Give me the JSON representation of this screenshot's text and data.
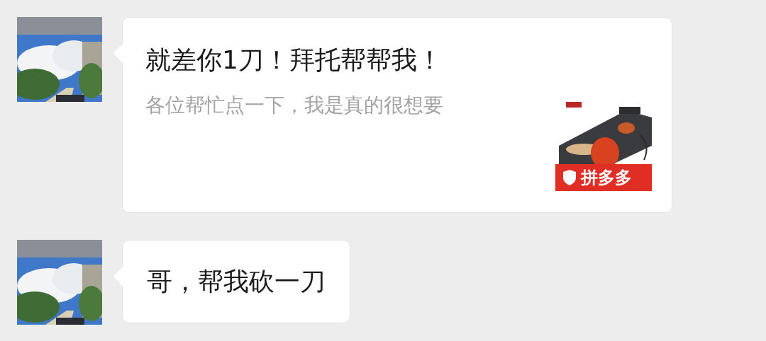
{
  "messages": [
    {
      "kind": "card",
      "title": "就差你1刀！拜托帮帮我！",
      "description": "各位帮忙点一下，我是真的很想要",
      "thumbnail": {
        "kind": "picture",
        "badge": "拼多多"
      }
    },
    {
      "kind": "text",
      "text": "哥，帮我砍一刀"
    }
  ]
}
